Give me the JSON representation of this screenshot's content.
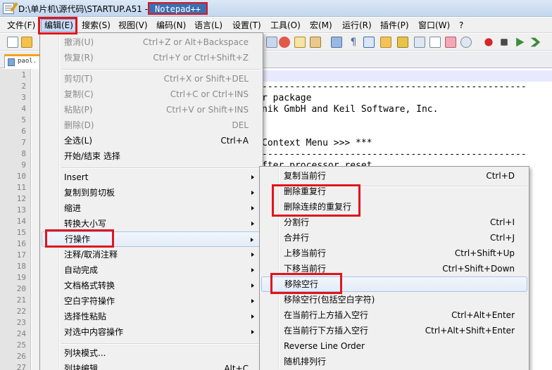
{
  "window": {
    "title_path": "D:\\单片机\\源代码\\STARTUP.A51 -",
    "app_name": "Notepad++"
  },
  "menubar": [
    {
      "label": "文件(F)"
    },
    {
      "label": "编辑(E)"
    },
    {
      "label": "搜索(S)"
    },
    {
      "label": "视图(V)"
    },
    {
      "label": "编码(N)"
    },
    {
      "label": "语言(L)"
    },
    {
      "label": "设置(T)"
    },
    {
      "label": "工具(O)"
    },
    {
      "label": "宏(M)"
    },
    {
      "label": "运行(R)"
    },
    {
      "label": "插件(P)"
    },
    {
      "label": "窗口(W)"
    },
    {
      "label": "?"
    }
  ],
  "tab": {
    "label": "paol."
  },
  "editor": {
    "line_numbers": [
      "1",
      "2",
      "3",
      "4",
      "5",
      "6",
      "7",
      "8",
      "9",
      "10",
      "11",
      "12",
      "13",
      "14",
      "15",
      "16",
      "17",
      "18",
      "19",
      "20",
      "21",
      "22",
      "23",
      "24",
      "25",
      "26",
      "27"
    ],
    "code_lines": [
      {
        "text": "------------------------------------------------"
      },
      {
        "text": "r package"
      },
      {
        "text": "nik GmbH and Keil Software, Inc."
      },
      {
        "text": "Context Menu >>> ***"
      },
      {
        "text": "------------------------------------------------"
      },
      {
        "text": "fter processor reset"
      }
    ]
  },
  "edit_menu": {
    "items": [
      {
        "label": "撤消(U)",
        "shortcut": "Ctrl+Z or Alt+Backspace"
      },
      {
        "label": "恢复(R)",
        "shortcut": "Ctrl+Y or Ctrl+Shift+Z"
      },
      {
        "label": "剪切(T)",
        "shortcut": "Ctrl+X or Shift+DEL"
      },
      {
        "label": "复制(C)",
        "shortcut": "Ctrl+C or Ctrl+INS"
      },
      {
        "label": "粘贴(P)",
        "shortcut": "Ctrl+V or Shift+INS"
      },
      {
        "label": "删除(D)",
        "shortcut": "DEL"
      },
      {
        "label": "全选(L)",
        "shortcut": "Ctrl+A"
      },
      {
        "label": "开始/结束 选择",
        "shortcut": ""
      },
      {
        "label": "Insert",
        "shortcut": ""
      },
      {
        "label": "复制到剪切板",
        "shortcut": ""
      },
      {
        "label": "缩进",
        "shortcut": ""
      },
      {
        "label": "转换大小写",
        "shortcut": ""
      },
      {
        "label": "行操作",
        "shortcut": ""
      },
      {
        "label": "注释/取消注释",
        "shortcut": ""
      },
      {
        "label": "自动完成",
        "shortcut": ""
      },
      {
        "label": "文档格式转换",
        "shortcut": ""
      },
      {
        "label": "空白字符操作",
        "shortcut": ""
      },
      {
        "label": "选择性粘贴",
        "shortcut": ""
      },
      {
        "label": "对选中内容操作",
        "shortcut": ""
      },
      {
        "label": "列块模式...",
        "shortcut": ""
      },
      {
        "label": "列块编辑",
        "shortcut": "Alt+C"
      }
    ]
  },
  "line_ops_menu": {
    "items": [
      {
        "label": "复制当前行",
        "shortcut": "Ctrl+D"
      },
      {
        "label": "删除重复行",
        "shortcut": ""
      },
      {
        "label": "删除连续的重复行",
        "shortcut": ""
      },
      {
        "label": "分割行",
        "shortcut": "Ctrl+I"
      },
      {
        "label": "合并行",
        "shortcut": "Ctrl+J"
      },
      {
        "label": "上移当前行",
        "shortcut": "Ctrl+Shift+Up"
      },
      {
        "label": "下移当前行",
        "shortcut": "Ctrl+Shift+Down"
      },
      {
        "label": "移除空行",
        "shortcut": ""
      },
      {
        "label": "移除空行(包括空白字符)",
        "shortcut": ""
      },
      {
        "label": "在当前行上方插入空行",
        "shortcut": "Ctrl+Alt+Enter"
      },
      {
        "label": "在当前行下方插入空行",
        "shortcut": "Ctrl+Alt+Shift+Enter"
      },
      {
        "label": "Reverse Line Order",
        "shortcut": ""
      },
      {
        "label": "随机排列行",
        "shortcut": ""
      }
    ]
  },
  "colors": {
    "highlight_box": "#e0141e",
    "title_bg": "#3b6fb0"
  }
}
